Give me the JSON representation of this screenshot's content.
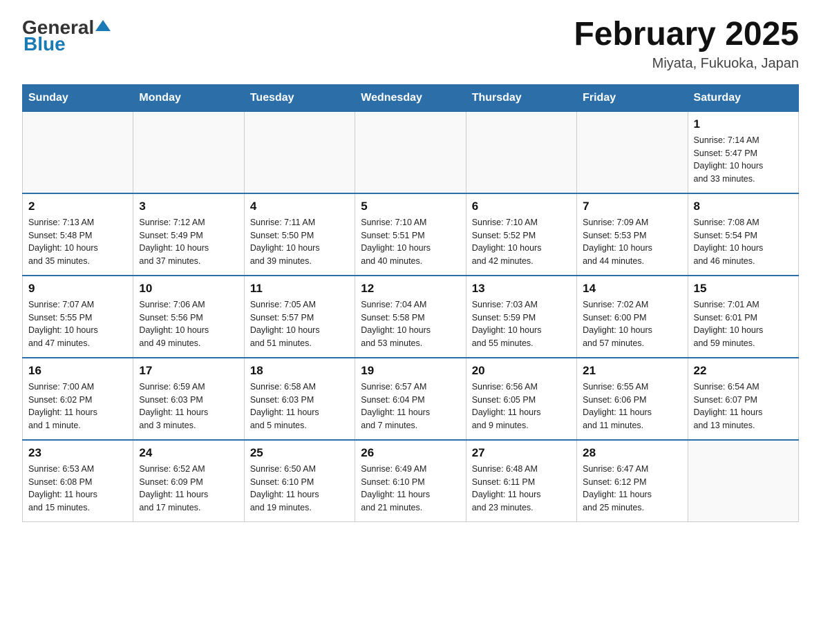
{
  "header": {
    "logo_general": "General",
    "logo_blue": "Blue",
    "title": "February 2025",
    "subtitle": "Miyata, Fukuoka, Japan"
  },
  "days_of_week": [
    "Sunday",
    "Monday",
    "Tuesday",
    "Wednesday",
    "Thursday",
    "Friday",
    "Saturday"
  ],
  "weeks": [
    {
      "days": [
        {
          "num": "",
          "info": ""
        },
        {
          "num": "",
          "info": ""
        },
        {
          "num": "",
          "info": ""
        },
        {
          "num": "",
          "info": ""
        },
        {
          "num": "",
          "info": ""
        },
        {
          "num": "",
          "info": ""
        },
        {
          "num": "1",
          "info": "Sunrise: 7:14 AM\nSunset: 5:47 PM\nDaylight: 10 hours\nand 33 minutes."
        }
      ]
    },
    {
      "days": [
        {
          "num": "2",
          "info": "Sunrise: 7:13 AM\nSunset: 5:48 PM\nDaylight: 10 hours\nand 35 minutes."
        },
        {
          "num": "3",
          "info": "Sunrise: 7:12 AM\nSunset: 5:49 PM\nDaylight: 10 hours\nand 37 minutes."
        },
        {
          "num": "4",
          "info": "Sunrise: 7:11 AM\nSunset: 5:50 PM\nDaylight: 10 hours\nand 39 minutes."
        },
        {
          "num": "5",
          "info": "Sunrise: 7:10 AM\nSunset: 5:51 PM\nDaylight: 10 hours\nand 40 minutes."
        },
        {
          "num": "6",
          "info": "Sunrise: 7:10 AM\nSunset: 5:52 PM\nDaylight: 10 hours\nand 42 minutes."
        },
        {
          "num": "7",
          "info": "Sunrise: 7:09 AM\nSunset: 5:53 PM\nDaylight: 10 hours\nand 44 minutes."
        },
        {
          "num": "8",
          "info": "Sunrise: 7:08 AM\nSunset: 5:54 PM\nDaylight: 10 hours\nand 46 minutes."
        }
      ]
    },
    {
      "days": [
        {
          "num": "9",
          "info": "Sunrise: 7:07 AM\nSunset: 5:55 PM\nDaylight: 10 hours\nand 47 minutes."
        },
        {
          "num": "10",
          "info": "Sunrise: 7:06 AM\nSunset: 5:56 PM\nDaylight: 10 hours\nand 49 minutes."
        },
        {
          "num": "11",
          "info": "Sunrise: 7:05 AM\nSunset: 5:57 PM\nDaylight: 10 hours\nand 51 minutes."
        },
        {
          "num": "12",
          "info": "Sunrise: 7:04 AM\nSunset: 5:58 PM\nDaylight: 10 hours\nand 53 minutes."
        },
        {
          "num": "13",
          "info": "Sunrise: 7:03 AM\nSunset: 5:59 PM\nDaylight: 10 hours\nand 55 minutes."
        },
        {
          "num": "14",
          "info": "Sunrise: 7:02 AM\nSunset: 6:00 PM\nDaylight: 10 hours\nand 57 minutes."
        },
        {
          "num": "15",
          "info": "Sunrise: 7:01 AM\nSunset: 6:01 PM\nDaylight: 10 hours\nand 59 minutes."
        }
      ]
    },
    {
      "days": [
        {
          "num": "16",
          "info": "Sunrise: 7:00 AM\nSunset: 6:02 PM\nDaylight: 11 hours\nand 1 minute."
        },
        {
          "num": "17",
          "info": "Sunrise: 6:59 AM\nSunset: 6:03 PM\nDaylight: 11 hours\nand 3 minutes."
        },
        {
          "num": "18",
          "info": "Sunrise: 6:58 AM\nSunset: 6:03 PM\nDaylight: 11 hours\nand 5 minutes."
        },
        {
          "num": "19",
          "info": "Sunrise: 6:57 AM\nSunset: 6:04 PM\nDaylight: 11 hours\nand 7 minutes."
        },
        {
          "num": "20",
          "info": "Sunrise: 6:56 AM\nSunset: 6:05 PM\nDaylight: 11 hours\nand 9 minutes."
        },
        {
          "num": "21",
          "info": "Sunrise: 6:55 AM\nSunset: 6:06 PM\nDaylight: 11 hours\nand 11 minutes."
        },
        {
          "num": "22",
          "info": "Sunrise: 6:54 AM\nSunset: 6:07 PM\nDaylight: 11 hours\nand 13 minutes."
        }
      ]
    },
    {
      "days": [
        {
          "num": "23",
          "info": "Sunrise: 6:53 AM\nSunset: 6:08 PM\nDaylight: 11 hours\nand 15 minutes."
        },
        {
          "num": "24",
          "info": "Sunrise: 6:52 AM\nSunset: 6:09 PM\nDaylight: 11 hours\nand 17 minutes."
        },
        {
          "num": "25",
          "info": "Sunrise: 6:50 AM\nSunset: 6:10 PM\nDaylight: 11 hours\nand 19 minutes."
        },
        {
          "num": "26",
          "info": "Sunrise: 6:49 AM\nSunset: 6:10 PM\nDaylight: 11 hours\nand 21 minutes."
        },
        {
          "num": "27",
          "info": "Sunrise: 6:48 AM\nSunset: 6:11 PM\nDaylight: 11 hours\nand 23 minutes."
        },
        {
          "num": "28",
          "info": "Sunrise: 6:47 AM\nSunset: 6:12 PM\nDaylight: 11 hours\nand 25 minutes."
        },
        {
          "num": "",
          "info": ""
        }
      ]
    }
  ]
}
